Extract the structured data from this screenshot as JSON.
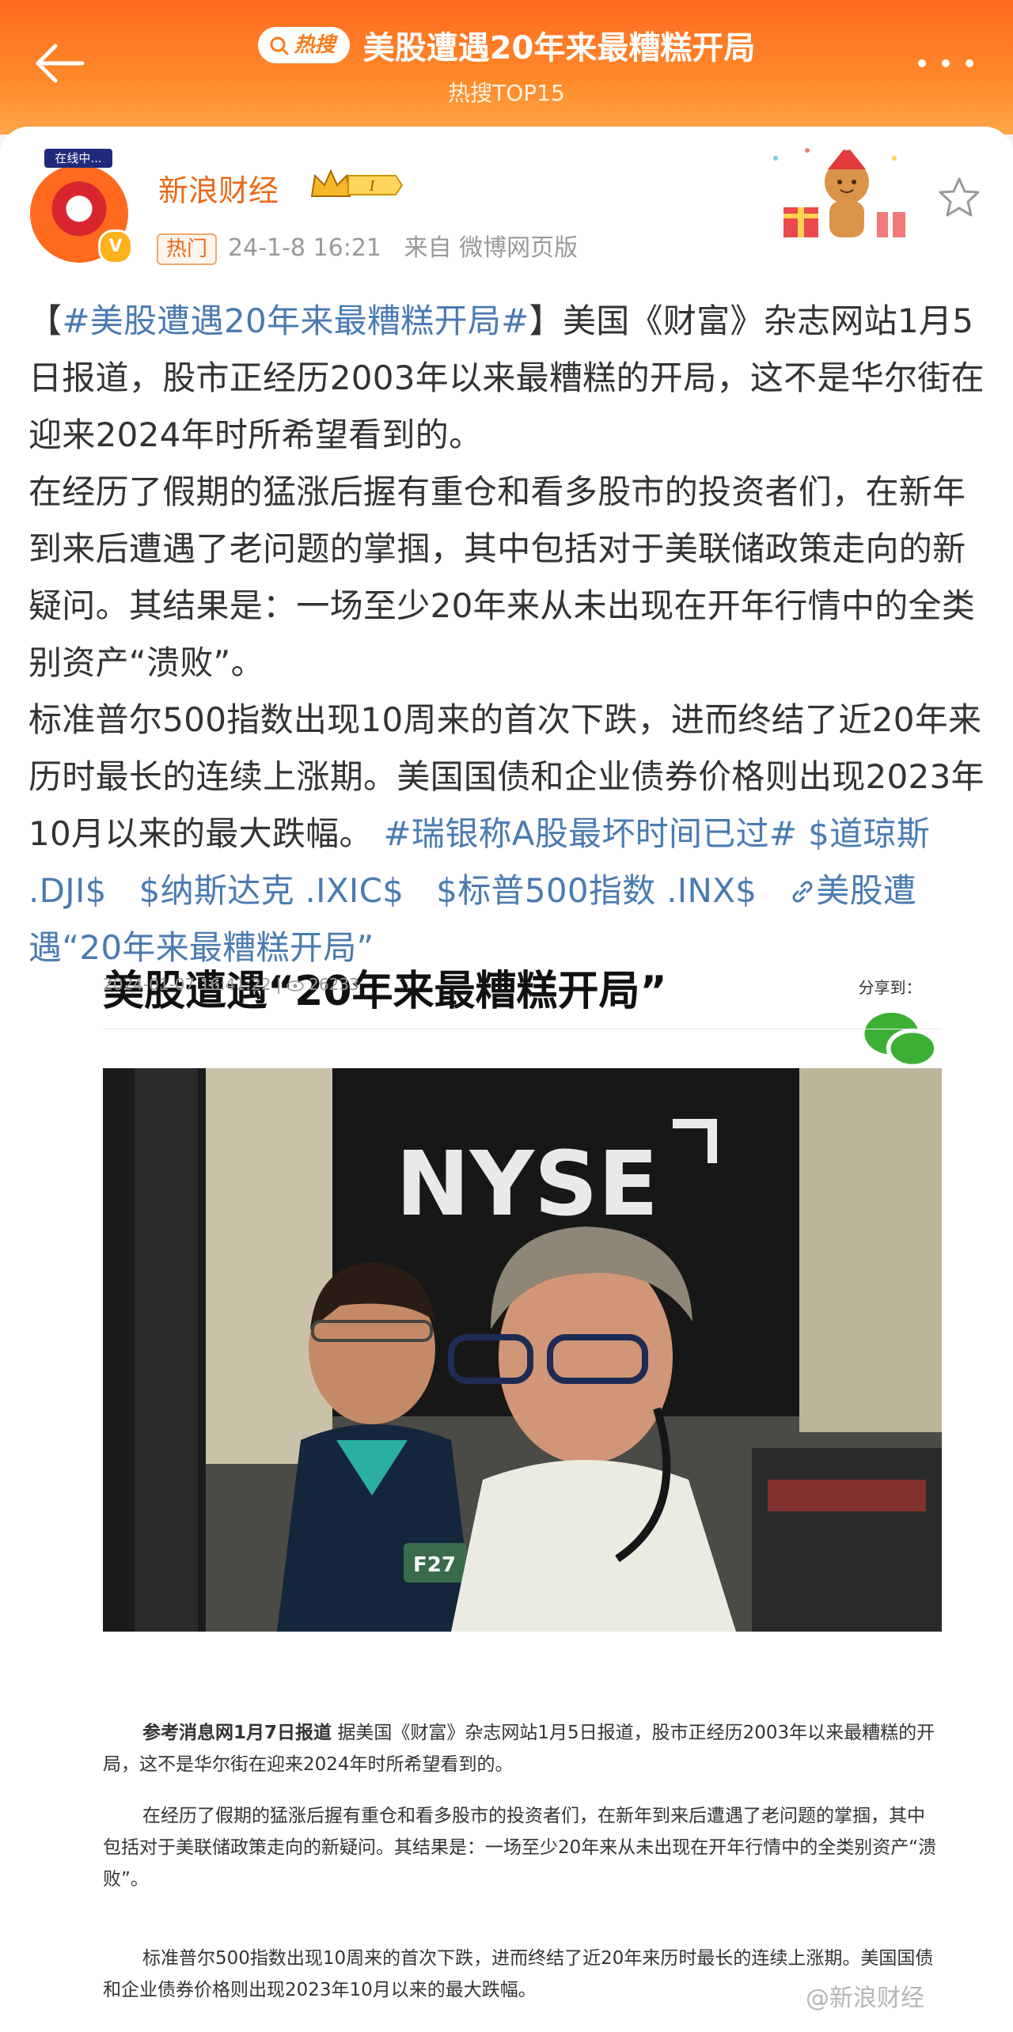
{
  "header": {
    "hot_label": "热搜",
    "title": "美股遭遇20年来最糟糕开局",
    "subtitle": "热搜TOP15",
    "colors": {
      "accent": "#ff7a1a",
      "link": "#4a7bb0"
    }
  },
  "post": {
    "author": "新浪财经",
    "avatar_badge": "在线中...",
    "tag": "热门",
    "time": "24-1-8 16:21",
    "source": "来自 微博网页版",
    "paragraph1": {
      "pre": "【",
      "topic": "#美股遭遇20年来最糟糕开局#",
      "post": "】美国《财富》杂志网站1月5日报道，股市正经历2003年以来最糟糕的开局，这不是华尔街在迎来2024年时所希望看到的。"
    },
    "paragraph2": "在经历了假期的猛涨后握有重仓和看多股市的投资者们，在新年到来后遭遇了老问题的掌掴，其中包括对于美联储政策走向的新疑问。其结果是：一场至少20年来从未出现在开年行情中的全类别资产“溃败”。",
    "paragraph3_text": "标准普尔500指数出现10周来的首次下跌，进而终结了近20年来历时最长的连续上涨期。美国国债和企业债券价格则出现2023年10月以来的最大跌幅。",
    "links": {
      "topic2": "#瑞银称A股最坏时间已过#",
      "stock1": "$道琼斯 .DJI$",
      "stock2": "$纳斯达克 .IXIC$",
      "stock3": "$标普500指数 .INX$",
      "web_link": "美股遭遇“20年来最糟糕开局”"
    }
  },
  "article": {
    "title": "美股遭遇“20年来最糟糕开局”",
    "date": "2024-01-07 16:41:22",
    "views": "26233",
    "share_label": "分享到：",
    "photo_sign": "NYSE",
    "badge": "F27",
    "para1_lead": "参考消息网1月7日报道",
    "para1": " 据美国《财富》杂志网站1月5日报道，股市正经历2003年以来最糟糕的开局，这不是华尔街在迎来2024年时所希望看到的。",
    "para2": "在经历了假期的猛涨后握有重仓和看多股市的投资者们，在新年到来后遭遇了老问题的掌掴，其中包括对于美联储政策走向的新疑问。其结果是：一场至少20年来从未出现在开年行情中的全类别资产“溃败”。",
    "para3": "标准普尔500指数出现10周来的首次下跌，进而终结了近20年来历时最长的连续上涨期。美国国债和企业债券价格则出现2023年10月以来的最大跌幅。"
  },
  "watermark": "@新浪财经"
}
